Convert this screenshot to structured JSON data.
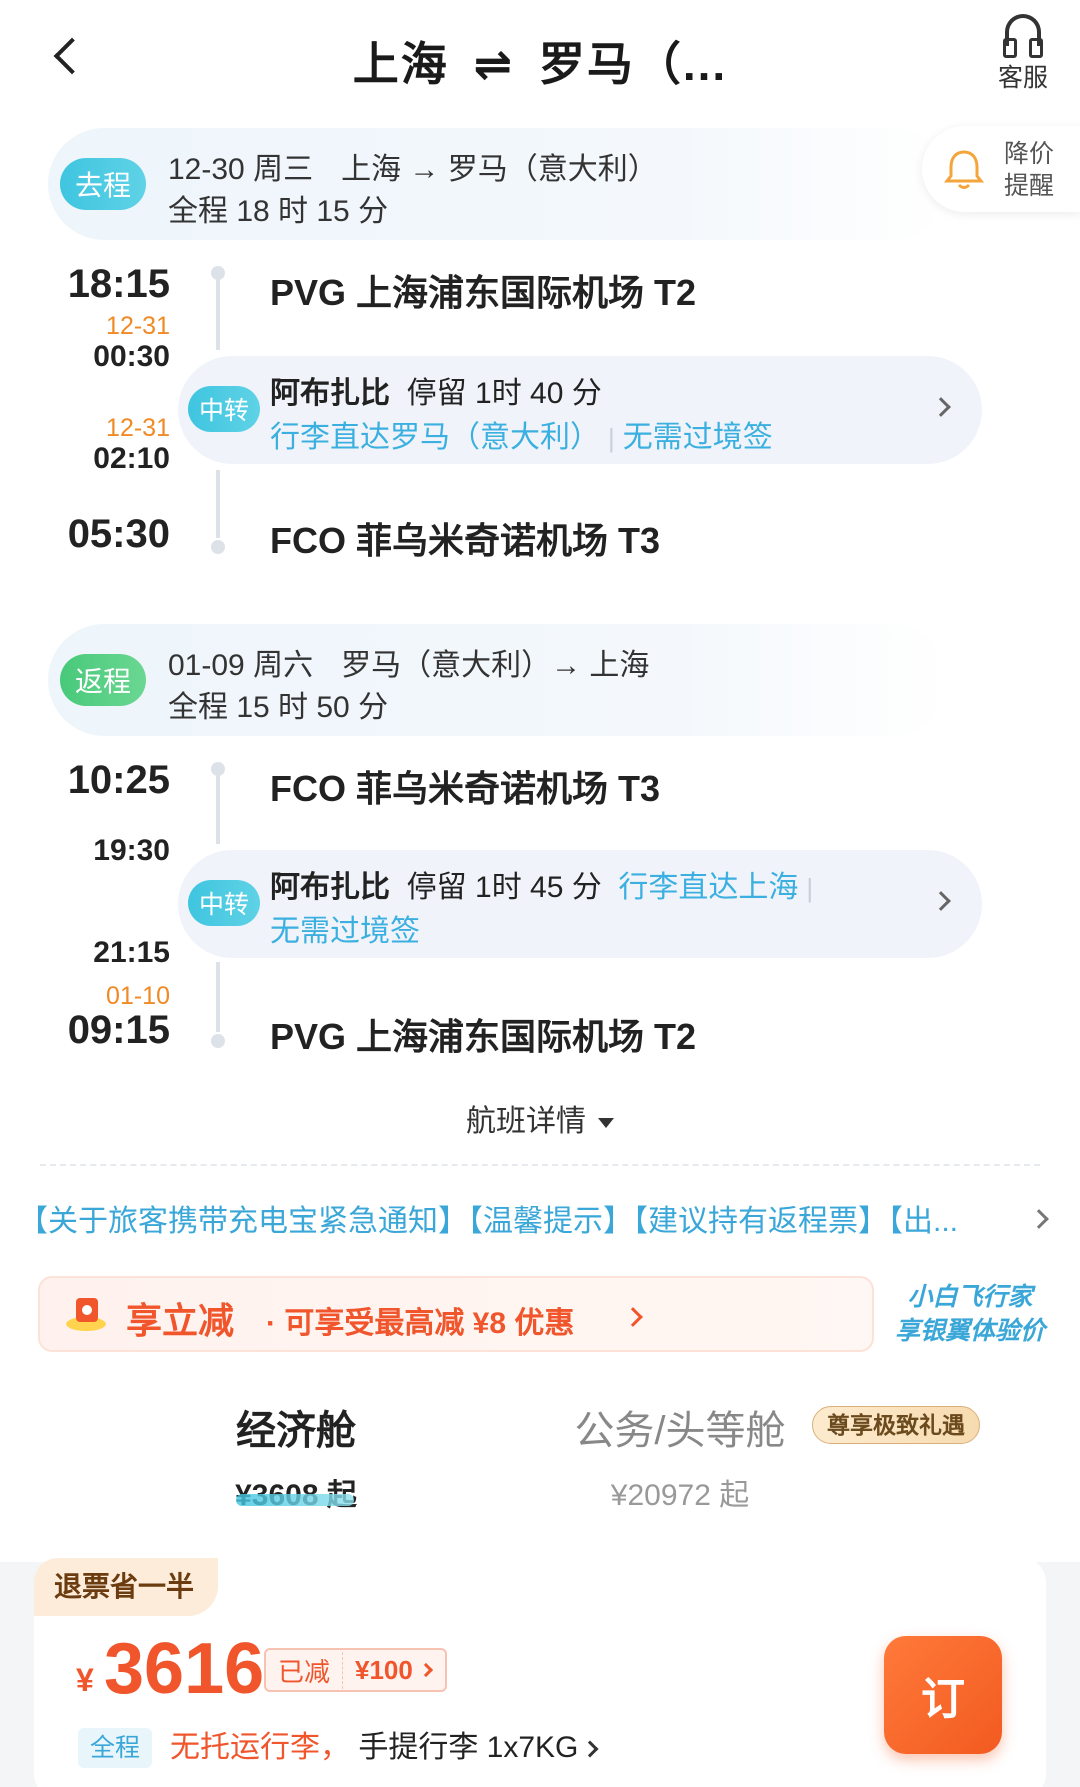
{
  "header": {
    "title_from": "上海",
    "title_swap_icon": "⇌",
    "title_to": "罗马（...",
    "customer_service_label": "客服"
  },
  "price_alert": {
    "label_line1": "降价",
    "label_line2": "提醒"
  },
  "outbound": {
    "badge": "去程",
    "date": "12-30 周三",
    "route": "上海 → 罗马（意大利）",
    "duration": "全程 18 时 15 分",
    "depart_time": "18:15",
    "depart_airport": "PVG 上海浦东国际机场 T2",
    "layover_arrive_date": "12-31",
    "layover_arrive_time": "00:30",
    "layover_depart_date": "12-31",
    "layover_depart_time": "02:10",
    "transfer": {
      "badge": "中转",
      "city": "阿布扎比",
      "stay": "停留 1时 40 分",
      "baggage": "行李直达罗马（意大利）",
      "visa": "无需过境签"
    },
    "arrive_time": "05:30",
    "arrive_airport": "FCO 菲乌米奇诺机场 T3"
  },
  "inbound": {
    "badge": "返程",
    "date": "01-09 周六",
    "route": "罗马（意大利）→ 上海",
    "duration": "全程 15 时 50 分",
    "depart_time": "10:25",
    "depart_airport": "FCO 菲乌米奇诺机场 T3",
    "layover_arrive_time": "19:30",
    "layover_depart_time": "21:15",
    "transfer": {
      "badge": "中转",
      "city": "阿布扎比",
      "stay": "停留 1时 45 分",
      "baggage": "行李直达上海",
      "visa": "无需过境签"
    },
    "arrive_date": "01-10",
    "arrive_time": "09:15",
    "arrive_airport": "PVG 上海浦东国际机场 T2"
  },
  "details_toggle": "航班详情",
  "notice": "【关于旅客携带充电宝紧急通知】【温馨提示】【建议持有返程票】【出...",
  "promo": {
    "main": "享立减",
    "sub": "· 可享受最高减 ¥8 优惠",
    "brand_line1": "小白飞行家",
    "brand_line2": "享银翼体验价"
  },
  "cabins": {
    "economy": {
      "name": "经济舱",
      "price": "¥3608 起"
    },
    "business": {
      "name": "公务/头等舱",
      "price": "¥20972 起",
      "badge": "尊享极致礼遇"
    }
  },
  "fare": {
    "tag": "退票省一半",
    "currency": "¥",
    "price": "3616",
    "discount_label": "已减",
    "discount_value": "¥100",
    "bag_tag": "全程",
    "no_checked": "无托运行李，",
    "carry_on": "手提行李 1x7KG",
    "book": "订"
  },
  "colors": {
    "accent_orange": "#f0552c",
    "accent_blue": "#3bb0e0",
    "go_badge": "#3fc5e0",
    "return_badge": "#48c97a"
  }
}
